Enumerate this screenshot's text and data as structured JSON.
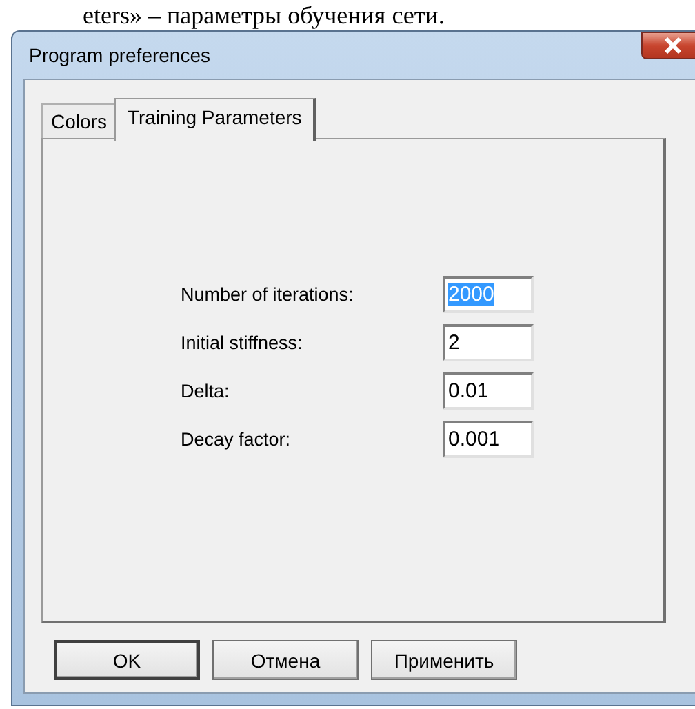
{
  "document_text": "eters» – параметры обучения сети.",
  "window": {
    "title": "Program preferences"
  },
  "tabs": [
    {
      "label": "Colors",
      "selected": false
    },
    {
      "label": "Training Parameters",
      "selected": true
    }
  ],
  "fields": [
    {
      "label": "Number of iterations:",
      "value": "2000",
      "text_selected": true
    },
    {
      "label": "Initial stiffness:",
      "value": "2",
      "text_selected": false
    },
    {
      "label": "Delta:",
      "value": "0.01",
      "text_selected": false
    },
    {
      "label": "Decay factor:",
      "value": "0.001",
      "text_selected": false
    }
  ],
  "buttons": [
    {
      "label": "OK",
      "default": true
    },
    {
      "label": "Отмена",
      "default": false
    },
    {
      "label": "Применить",
      "default": false
    }
  ]
}
